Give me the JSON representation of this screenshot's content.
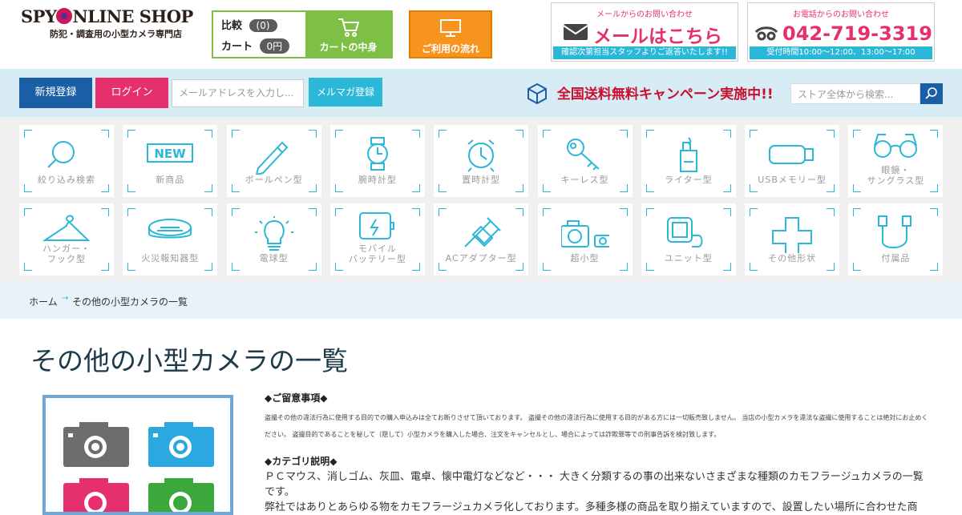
{
  "header": {
    "logo_line1": "SPY ONLINE SHOP",
    "logo_line2": "防犯・調査用の小型カメラ専門店",
    "compare_label": "比較",
    "compare_count": "(0)",
    "cart_label": "カート",
    "cart_total": "0円",
    "cart_button": "カートの中身",
    "flow_button": "ご利用の流れ",
    "mail_contact": {
      "caption": "メールからのお問い合わせ",
      "title": "メールはこちら",
      "note": "確認次第担当スタッフよりご返答いたします!!"
    },
    "phone_contact": {
      "caption": "お電話からのお問い合わせ",
      "number": "042-719-3319",
      "hours": "受付時間10:00～12:00、13:00～17:00"
    }
  },
  "nav": {
    "register": "新規登録",
    "login": "ログイン",
    "email_placeholder": "メールアドレスを入力し...",
    "newsletter": "メルマガ登録",
    "campaign": "全国送料無料キャンペーン実施中!!",
    "search_placeholder": "ストア全体から検索..."
  },
  "categories": [
    {
      "label": "絞り込み検索",
      "icon": "magnifier-icon"
    },
    {
      "label": "新商品",
      "icon": "new-badge-icon"
    },
    {
      "label": "ボールペン型",
      "icon": "pen-icon"
    },
    {
      "label": "腕時計型",
      "icon": "wristwatch-icon"
    },
    {
      "label": "置時計型",
      "icon": "alarm-clock-icon"
    },
    {
      "label": "キーレス型",
      "icon": "key-icon"
    },
    {
      "label": "ライター型",
      "icon": "lighter-icon"
    },
    {
      "label": "USBメモリー型",
      "icon": "usb-icon"
    },
    {
      "label": "眼鏡・\nサングラス型",
      "icon": "glasses-icon"
    },
    {
      "label": "ハンガー・\nフック型",
      "icon": "hanger-icon"
    },
    {
      "label": "火災報知器型",
      "icon": "smoke-detector-icon"
    },
    {
      "label": "電球型",
      "icon": "bulb-icon"
    },
    {
      "label": "モバイル\nバッテリー型",
      "icon": "battery-icon"
    },
    {
      "label": "ACアダプター型",
      "icon": "plug-icon"
    },
    {
      "label": "超小型",
      "icon": "mini-camera-icon"
    },
    {
      "label": "ユニット型",
      "icon": "unit-icon"
    },
    {
      "label": "その他形状",
      "icon": "plus-icon"
    },
    {
      "label": "付属品",
      "icon": "cable-icon"
    }
  ],
  "breadcrumb": {
    "home": "ホーム",
    "separator": "→",
    "current": "その他の小型カメラの一覧"
  },
  "page": {
    "title": "その他の小型カメラの一覧",
    "notice_heading": "◆ご留意事項◆",
    "notice_text": "盗撮その他の違法行為に使用する目的での購入申込みは全てお断りさせて頂いております。 盗撮その他の違法行為に使用する目的がある方には一切販売致しません。 当店の小型カメラを違法な盗撮に使用することは絶対にお止めください。 盗撮目的であることを秘して（隠して）小型カメラを購入した場合、注文をキャンセルとし、場合によっては詐欺罪等での刑事告訴を検討致します。",
    "category_heading": "◆カテゴリ説明◆",
    "category_text": "ＰＣマウス、消しゴム、灰皿、電卓、懐中電灯などなど・・・ 大きく分類するの事の出来ないさまざまな種類のカモフラージュカメラの一覧です。",
    "category_text2": "弊社ではありとあらゆる物をカモフラージュカメラ化しております。多種多様の商品を取り揃えていますので、設置したい場所に合わせた商"
  },
  "colors": {
    "accent": "#2bb7d8",
    "pink": "#e6306e",
    "green": "#7dc045",
    "orange": "#f7941d",
    "navy": "#1a5ea6",
    "campaign_red": "#c8102e"
  }
}
